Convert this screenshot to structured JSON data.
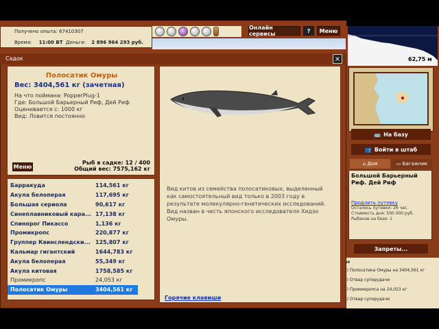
{
  "stats": {
    "experience_label": "Получено опыта:",
    "experience_value": "67410307",
    "time_label": "Время:",
    "time_value": "11:00 ВТ",
    "money_label": "Деньги:",
    "money_value": "2 896 964 293 руб."
  },
  "topbar": {
    "online_label": "Онлайн сервисы",
    "help_label": "?",
    "menu_label": "Меню"
  },
  "depth": {
    "value": "62,75 м"
  },
  "right": {
    "base_label": "На базу",
    "hq_label": "Войти в штаб",
    "tab_home": "Дом",
    "tab_baggage": "Багажник",
    "location_name": "Большой Барьерный Риф. Дей Риф",
    "extend_link": "Продлить путевку",
    "trip_left": "Осталось путевки: 26 час.",
    "trip_cost": "Стоимость дня: 500 000 руб.",
    "fishers": "Рыбаков на базе: 1",
    "bans_label": "Запреты..."
  },
  "log": {
    "header": "ия",
    "entries": [
      "а) Полосатика Омуры на 3404,561 кг",
      "а) Отвар суперудачи",
      "а) Промикропса на 24,053 кг",
      "а) Отвар суперудачи"
    ]
  },
  "window": {
    "title": "Садок",
    "close": "×"
  },
  "fish": {
    "name": "Полосатик Омуры",
    "weight": "Вес: 3404,561 кг (зачетная)",
    "caught_with": "На что поймана: PopperPlug-1",
    "where": "Где: Большой Барьерный Риф, Дей Риф",
    "value": "Оценивается с: 1000 кг",
    "kind": "Вид: Ловится постоянно",
    "menu_label": "Меню",
    "count": "Рыб в садке: 12 / 400",
    "total": "Общий вес: 7575,162 кг"
  },
  "catch_list": [
    {
      "name": "Барракуда",
      "weight": "114,561 кг",
      "style": "bold"
    },
    {
      "name": "Акула белоперая",
      "weight": "117,695 кг",
      "style": "bold"
    },
    {
      "name": "Большая сериола",
      "weight": "90,617 кг",
      "style": "bold"
    },
    {
      "name": "Синеплавниковый кара...",
      "weight": "17,138 кг",
      "style": "bold"
    },
    {
      "name": "Спинорог Пикассо",
      "weight": "1,136 кг",
      "style": "bold"
    },
    {
      "name": "Промикропс",
      "weight": "220,877 кг",
      "style": "bold"
    },
    {
      "name": "Группер Квинслендски...",
      "weight": "125,807 кг",
      "style": "bold"
    },
    {
      "name": "Кальмар гигантский",
      "weight": "1644,783 кг",
      "style": "bold"
    },
    {
      "name": "Акула белоперая",
      "weight": "55,349 кг",
      "style": "bold"
    },
    {
      "name": "Акула китовая",
      "weight": "1758,585 кг",
      "style": "bold"
    },
    {
      "name": "Промикропс",
      "weight": "24,053 кг",
      "style": "plain"
    },
    {
      "name": "Полосатик Омуры",
      "weight": "3404,561 кг",
      "style": "selected"
    }
  ],
  "description": {
    "text": "Вид китов из семейства полосатиковых, выделенный как самостоятельный вид только в 2003 году в результате молекулярно-генетических исследований. Вид назван в честь японского исследователя Хидэо Омуры.",
    "hotkeys_link": "Горячие клавиши"
  },
  "colors": {
    "frame": "#8a3c18",
    "parchment": "#efe3c6",
    "fish_name": "#c06010",
    "selected_row": "#1e7ae0",
    "link": "#1030c0"
  },
  "icons": [
    "lure-icon",
    "lure-icon",
    "lure-purple-icon",
    "lure-icon",
    "lure-icon",
    "bottle-icon"
  ]
}
